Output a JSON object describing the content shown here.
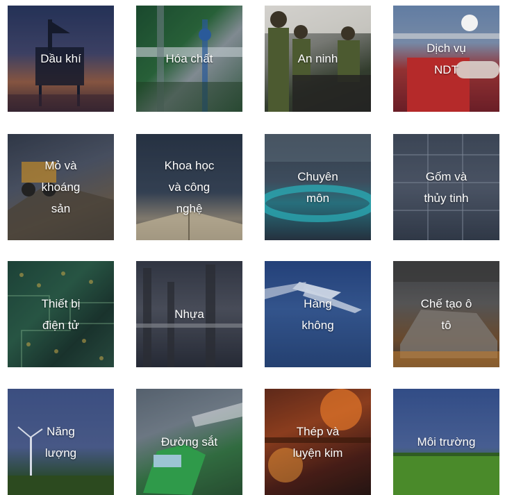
{
  "tiles": [
    {
      "label": "Dầu khí",
      "icon": "oil-rig-image",
      "theme": "oil"
    },
    {
      "label": "Hóa chất",
      "icon": "chemical-plant-image",
      "theme": "chem"
    },
    {
      "label": "An ninh",
      "icon": "security-image",
      "theme": "sec"
    },
    {
      "label": "Dịch vụ\nNDT",
      "icon": "ndt-service-image",
      "theme": "ndt"
    },
    {
      "label": "Mỏ và\nkhoáng\nsản",
      "icon": "mining-image",
      "theme": "mine"
    },
    {
      "label": "Khoa học\nvà công\nnghệ",
      "icon": "science-book-image",
      "theme": "sci"
    },
    {
      "label": "Chuyên\nmôn",
      "icon": "professional-image",
      "theme": "pro"
    },
    {
      "label": "Gốm và\nthủy tinh",
      "icon": "ceramics-glass-image",
      "theme": "glass"
    },
    {
      "label": "Thiết bị\nđiện tử",
      "icon": "circuit-board-image",
      "theme": "elec"
    },
    {
      "label": "Nhựa",
      "icon": "plastics-factory-image",
      "theme": "plas"
    },
    {
      "label": "Hàng\nkhông",
      "icon": "airplane-image",
      "theme": "air"
    },
    {
      "label": "Chế tạo ô\ntô",
      "icon": "car-assembly-image",
      "theme": "auto"
    },
    {
      "label": "Năng\nlượng",
      "icon": "wind-turbine-image",
      "theme": "energy"
    },
    {
      "label": "Đường sắt",
      "icon": "train-image",
      "theme": "rail"
    },
    {
      "label": "Thép và\nluyện kim",
      "icon": "steel-furnace-image",
      "theme": "steel"
    },
    {
      "label": "Môi trường",
      "icon": "field-landscape-image",
      "theme": "env"
    }
  ]
}
